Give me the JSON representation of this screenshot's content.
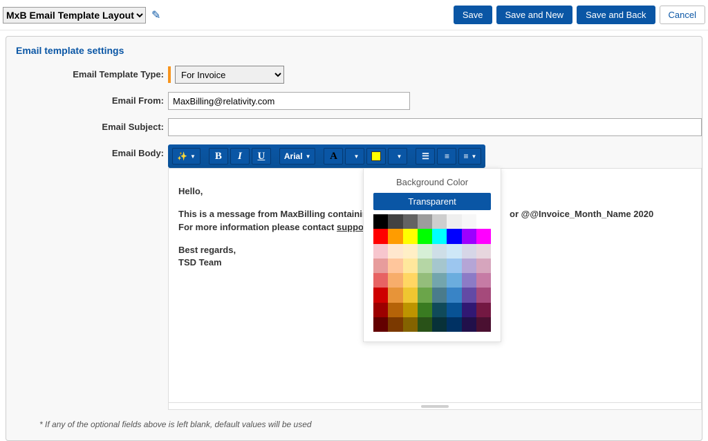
{
  "topbar": {
    "layout_option": "MxB Email Template Layout",
    "save": "Save",
    "save_new": "Save and New",
    "save_back": "Save and Back",
    "cancel": "Cancel"
  },
  "panel": {
    "title": "Email template settings",
    "labels": {
      "template_type": "Email Template Type:",
      "email_from": "Email From:",
      "email_subject": "Email Subject:",
      "email_body": "Email Body:"
    },
    "values": {
      "template_type": "For Invoice",
      "email_from": "MaxBilling@relativity.com",
      "email_subject": ""
    }
  },
  "toolbar": {
    "font_family": "Arial"
  },
  "popup": {
    "title": "Background Color",
    "transparent": "Transparent",
    "colors": [
      "#000000",
      "#424242",
      "#636363",
      "#9c9c9c",
      "#cecece",
      "#efefef",
      "#f7f7f7",
      "#ffffff",
      "#ff0000",
      "#ff9c00",
      "#ffff00",
      "#00ff00",
      "#00ffff",
      "#0000ff",
      "#9c00ff",
      "#ff00ff",
      "#f7c6ce",
      "#ffe7ce",
      "#ffefc6",
      "#d6efd6",
      "#cedee7",
      "#cee7f7",
      "#d6d6e7",
      "#e7d6de",
      "#e79c9c",
      "#ffc69c",
      "#ffe79c",
      "#b5d6a5",
      "#a5c6ce",
      "#9cc6ef",
      "#b5a5d6",
      "#d6a5bd",
      "#e76363",
      "#f7ad6b",
      "#ffd663",
      "#94bd7b",
      "#73a5ad",
      "#6badde",
      "#8c7bc6",
      "#c67ba5",
      "#ce0000",
      "#e79439",
      "#efc631",
      "#6ba54a",
      "#4a7b8c",
      "#3984c6",
      "#634aa5",
      "#a54a7b",
      "#9c0000",
      "#b56308",
      "#bd9400",
      "#397b21",
      "#104a5a",
      "#085294",
      "#311873",
      "#731842",
      "#630000",
      "#7b3900",
      "#846300",
      "#295218",
      "#083139",
      "#003163",
      "#21104a",
      "#4a1031"
    ]
  },
  "body": {
    "greeting": "Hello,",
    "line1_a": "This is a message from MaxBilling containin",
    "line1_b": "or @@Invoice_Month_Name 2020",
    "line2_a": "For more information please contact ",
    "line2_b": "suppor",
    "signoff": "Best regards,",
    "team": "TSD Team"
  },
  "footnote": "* If any of the optional fields above is left blank, default values will be used"
}
